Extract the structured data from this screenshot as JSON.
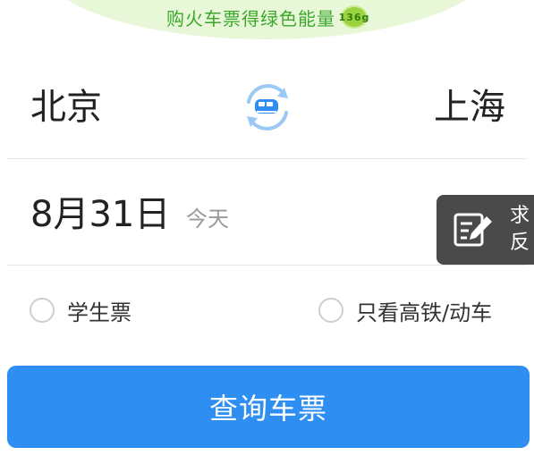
{
  "banner": {
    "text": "购火车票得绿色能量",
    "badge": "136g"
  },
  "route": {
    "from": "北京",
    "to": "上海",
    "swap_icon": "train-swap-icon"
  },
  "date": {
    "value": "8月31日",
    "hint": "今天"
  },
  "feedback": {
    "line1": "求",
    "line2": "反",
    "icon": "edit-feedback-icon"
  },
  "options": {
    "student_label": "学生票",
    "highspeed_label": "只看高铁/动车"
  },
  "search": {
    "label": "查询车票"
  },
  "colors": {
    "primary": "#2e8ef2",
    "banner_bg": "#e8f7d8",
    "banner_text": "#3ba72b",
    "feedback_bg": "#4a4a4a"
  }
}
